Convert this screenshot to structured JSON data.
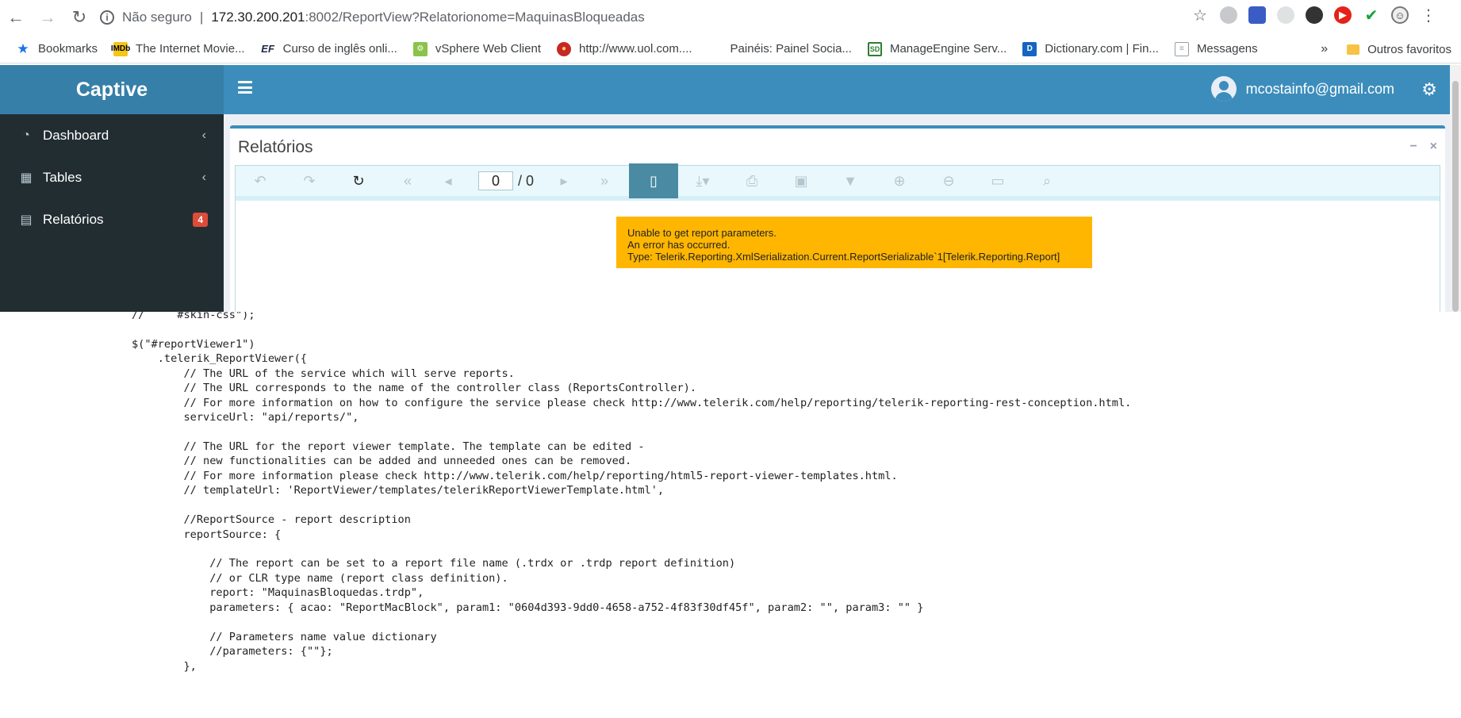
{
  "browser": {
    "not_secure": "Não seguro",
    "url_host": "172.30.200.201",
    "url_path": ":8002/ReportView?Relatorionome=MaquinasBloqueadas"
  },
  "bookmarks": {
    "items": [
      {
        "label": "Bookmarks",
        "icon": "star-icon"
      },
      {
        "label": "The Internet Movie...",
        "icon": "imdb-icon"
      },
      {
        "label": "Curso de inglês onli...",
        "icon": "ef-icon"
      },
      {
        "label": "vSphere Web Client",
        "icon": "vsphere-icon"
      },
      {
        "label": "http://www.uol.com....",
        "icon": "uol-icon"
      },
      {
        "label": "Painéis: Painel Socia...",
        "icon": "windows-icon"
      },
      {
        "label": "ManageEngine Serv...",
        "icon": "manageengine-icon"
      },
      {
        "label": "Dictionary.com | Fin...",
        "icon": "dictionary-icon"
      },
      {
        "label": "Messagens",
        "icon": "document-icon"
      }
    ],
    "more": "»",
    "other": "Outros favoritos"
  },
  "app": {
    "brand": "Captive",
    "user_email": "mcostainfo@gmail.com"
  },
  "sidebar": {
    "items": [
      {
        "label": "Dashboard",
        "icon": "dashboard-icon"
      },
      {
        "label": "Tables",
        "icon": "table-icon"
      },
      {
        "label": "Relatórios",
        "icon": "calendar-icon",
        "badge": "4"
      }
    ]
  },
  "box": {
    "title": "Relatórios",
    "minimize": "−",
    "close": "×"
  },
  "viewer": {
    "page_value": "0",
    "page_total": "/ 0"
  },
  "error": {
    "line1": "Unable to get report parameters.",
    "line2": "An error has occurred.",
    "line3": "Type: Telerik.Reporting.XmlSerialization.Current.ReportSerializable`1[Telerik.Reporting.Report]"
  },
  "code": {
    "lines": [
      "//     #skin-css\");",
      "",
      "$(\"#reportViewer1\")",
      "    .telerik_ReportViewer({",
      "        // The URL of the service which will serve reports.",
      "        // The URL corresponds to the name of the controller class (ReportsController).",
      "        // For more information on how to configure the service please check http://www.telerik.com/help/reporting/telerik-reporting-rest-conception.html.",
      "        serviceUrl: \"api/reports/\",",
      "",
      "        // The URL for the report viewer template. The template can be edited -",
      "        // new functionalities can be added and unneeded ones can be removed.",
      "        // For more information please check http://www.telerik.com/help/reporting/html5-report-viewer-templates.html.",
      "        // templateUrl: 'ReportViewer/templates/telerikReportViewerTemplate.html',",
      "",
      "        //ReportSource - report description",
      "        reportSource: {",
      "",
      "            // The report can be set to a report file name (.trdx or .trdp report definition)",
      "            // or CLR type name (report class definition).",
      "            report: \"MaquinasBloquedas.trdp\",",
      "            parameters: { acao: \"ReportMacBlock\", param1: \"0604d393-9dd0-4658-a752-4f83f30df45f\", param2: \"\", param3: \"\" }",
      "",
      "            // Parameters name value dictionary",
      "            //parameters: {\"\"};",
      "        },"
    ]
  }
}
